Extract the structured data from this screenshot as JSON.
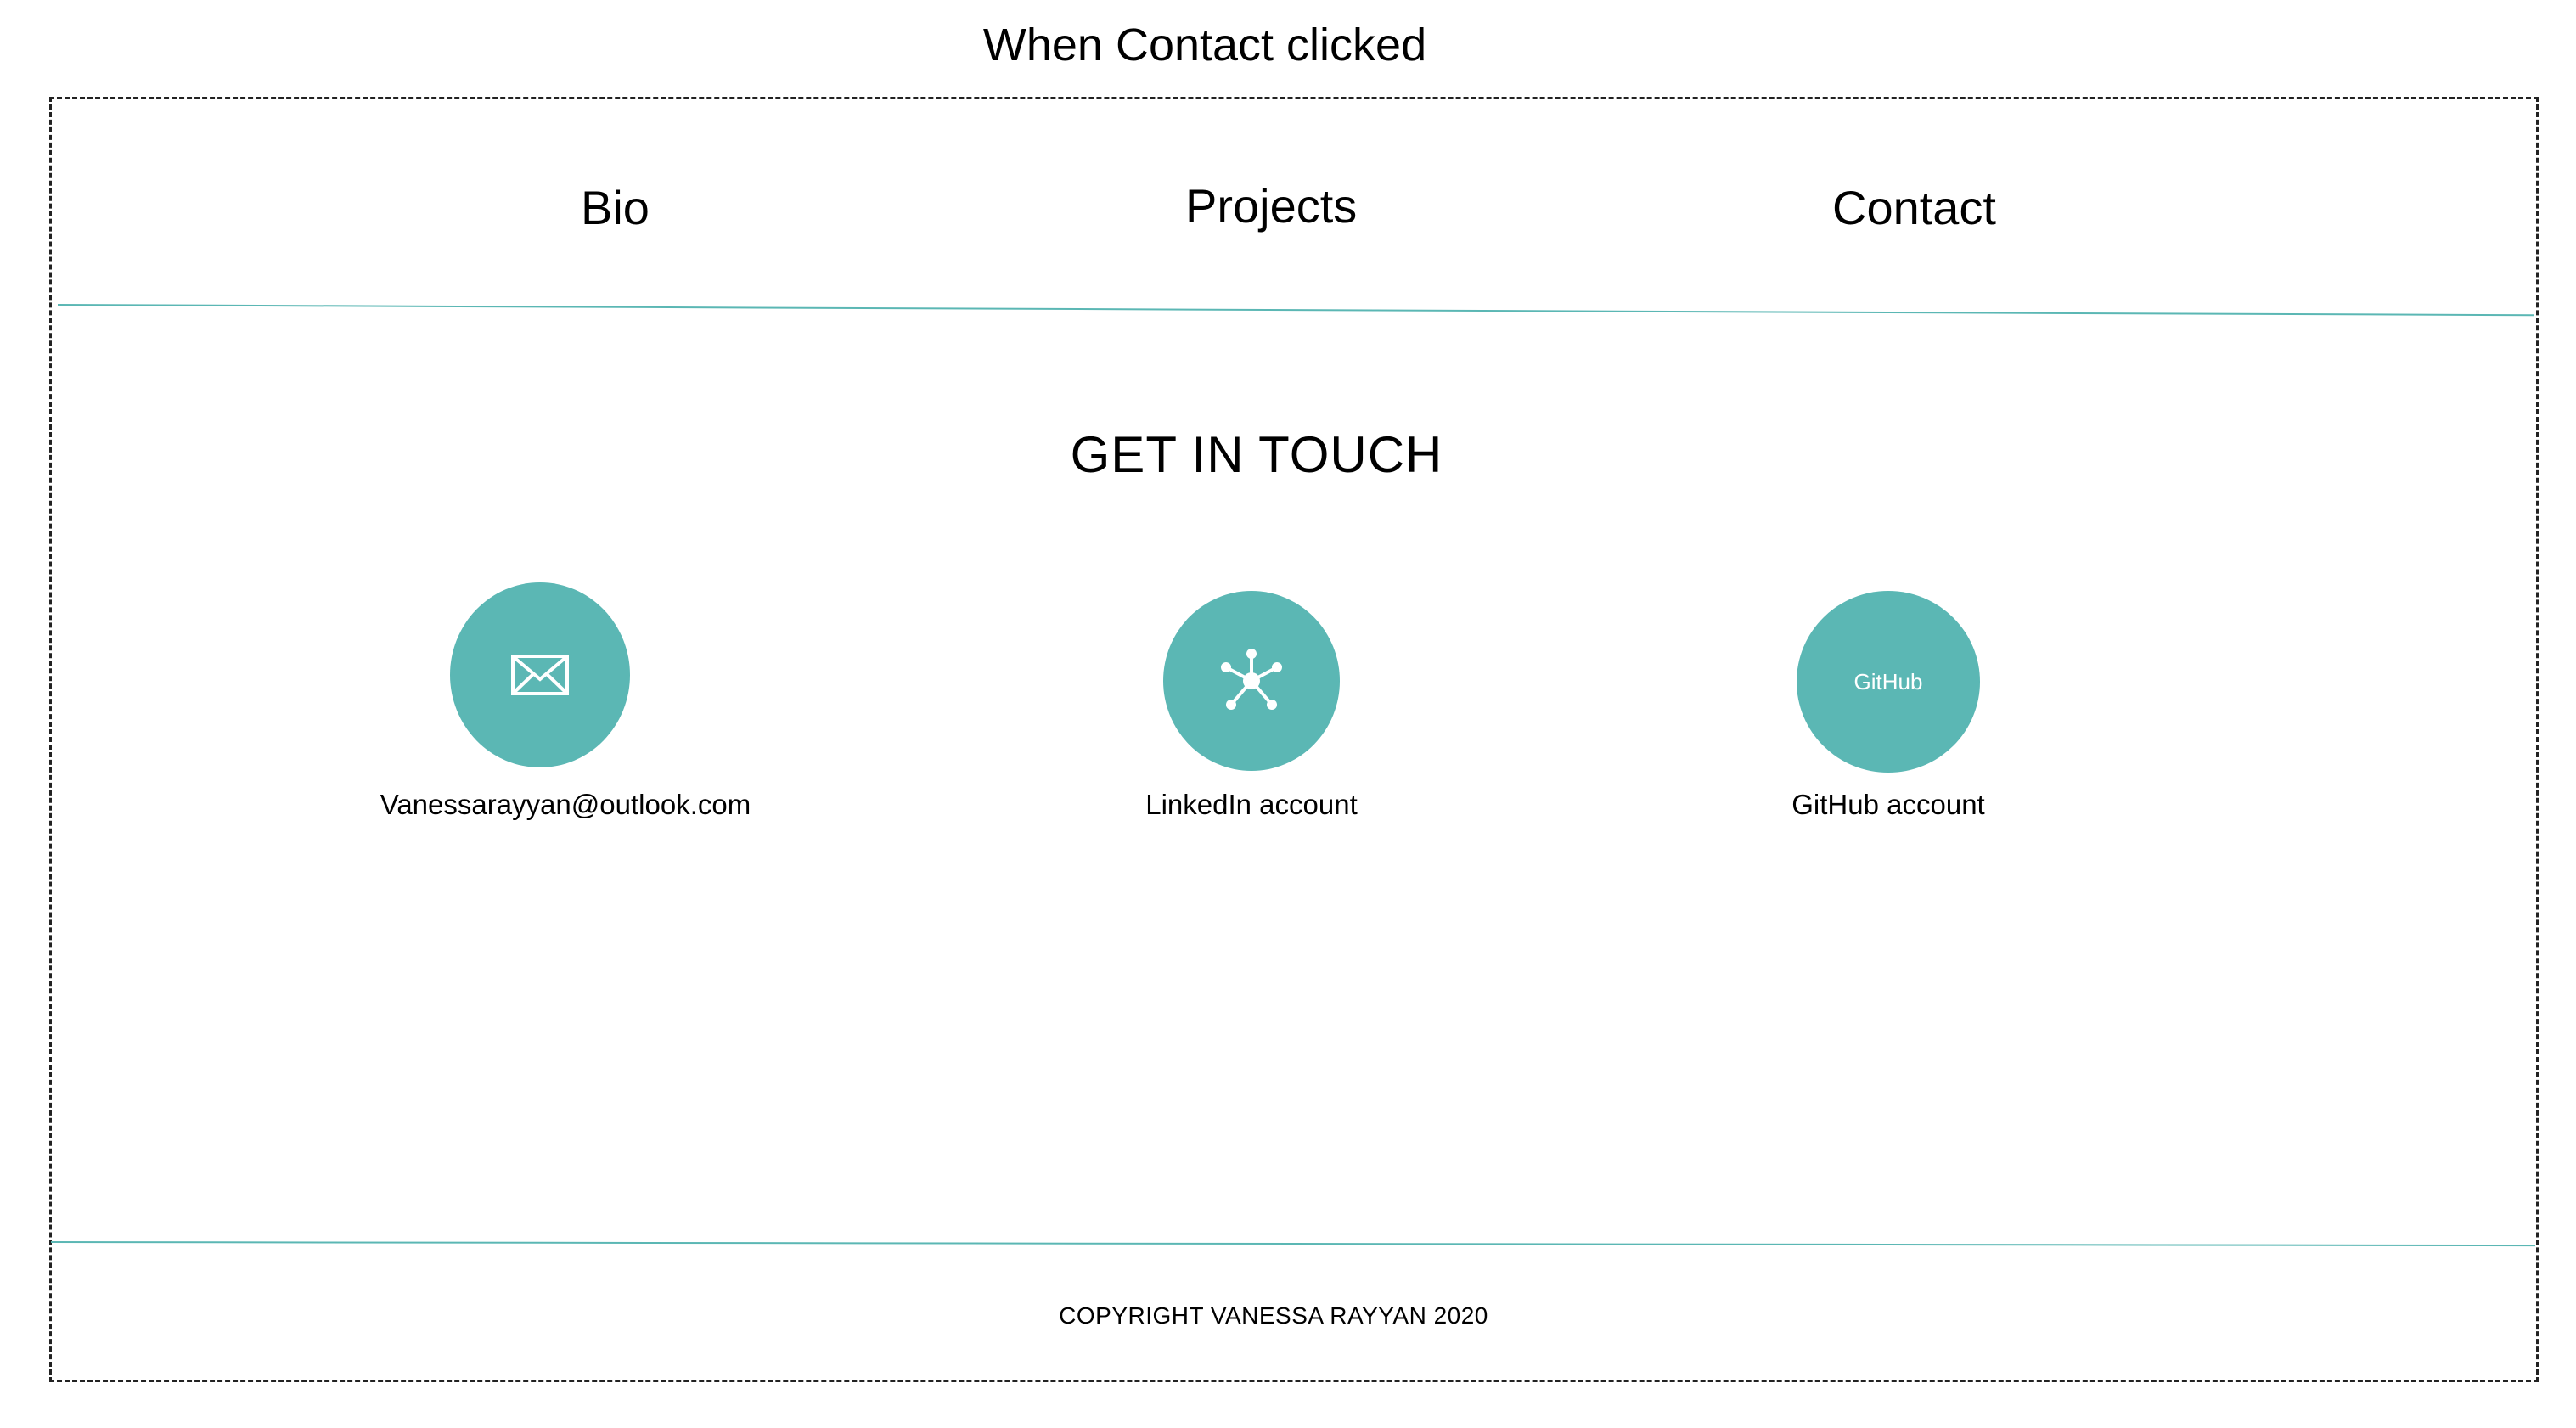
{
  "caption": "When Contact clicked",
  "nav": {
    "items": [
      {
        "label": "Bio"
      },
      {
        "label": "Projects"
      },
      {
        "label": "Contact"
      }
    ]
  },
  "main": {
    "heading": "GET IN TOUCH",
    "contacts": [
      {
        "icon": "envelope-icon",
        "label": "Vanessarayyan@outlook.com"
      },
      {
        "icon": "network-icon",
        "label": "LinkedIn account"
      },
      {
        "icon": "github-icon",
        "icon_text": "GitHub",
        "label": "GitHub account"
      }
    ]
  },
  "footer": {
    "copyright": "COPYRIGHT VANESSA RAYYAN 2020"
  },
  "colors": {
    "accent": "#5bb7b4",
    "text": "#000000",
    "border": "#222222"
  }
}
